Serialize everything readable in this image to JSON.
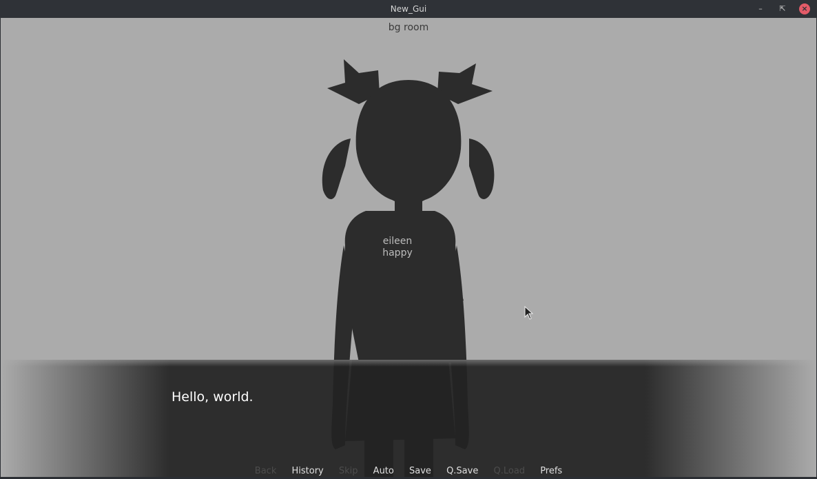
{
  "window": {
    "title": "New_Gui"
  },
  "scene": {
    "background_label": "bg room"
  },
  "character": {
    "label_line1": "eileen",
    "label_line2": "happy"
  },
  "dialogue": {
    "text": "Hello, world."
  },
  "quick_menu": {
    "back": "Back",
    "history": "History",
    "skip": "Skip",
    "auto": "Auto",
    "save": "Save",
    "qsave": "Q.Save",
    "qload": "Q.Load",
    "prefs": "Prefs"
  },
  "colors": {
    "background": "#ababab",
    "silhouette": "#2c2c2c",
    "textbox": "#222222",
    "close": "#e35b68"
  }
}
